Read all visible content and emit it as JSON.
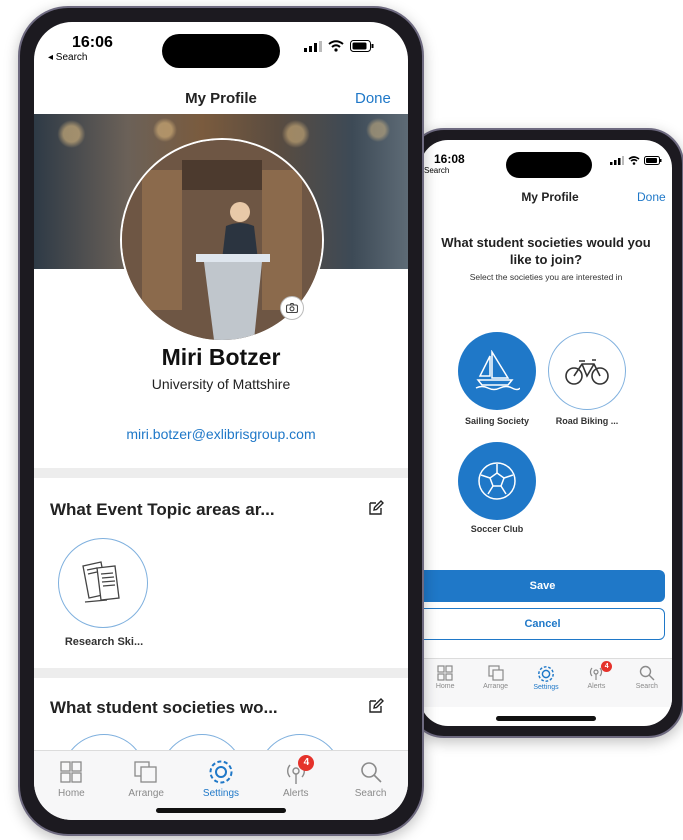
{
  "colors": {
    "accent": "#1f78c8",
    "badge": "#e5322b",
    "frame": "#1c1a20"
  },
  "front": {
    "status": {
      "time": "16:06",
      "back": "◂ Search"
    },
    "nav": {
      "title": "My Profile",
      "done": "Done"
    },
    "profile": {
      "name": "Miri Botzer",
      "institution": "University of Mattshire",
      "email": "miri.botzer@exlibrisgroup.com"
    },
    "sections": [
      {
        "title": "What Event Topic areas ar...",
        "items": [
          {
            "label": "Research Ski...",
            "icon": "books-icon"
          }
        ]
      },
      {
        "title": "What student societies wo..."
      }
    ],
    "tabs": [
      {
        "label": "Home",
        "icon": "grid-icon"
      },
      {
        "label": "Arrange",
        "icon": "stack-icon"
      },
      {
        "label": "Settings",
        "icon": "gear-icon"
      },
      {
        "label": "Alerts",
        "icon": "broadcast-icon",
        "badge": "4"
      },
      {
        "label": "Search",
        "icon": "search-icon"
      }
    ]
  },
  "back": {
    "status": {
      "time": "16:08",
      "back": "Search"
    },
    "nav": {
      "title": "My Profile",
      "done": "Done"
    },
    "heading": "What student societies would you like to join?",
    "subheading": "Select the societies you are interested in",
    "societies": [
      {
        "label": "Sailing Society",
        "icon": "sailboat-icon",
        "selected": true
      },
      {
        "label": "Road Biking ...",
        "icon": "bicycle-icon",
        "selected": false
      },
      {
        "label": "Soccer Club",
        "icon": "soccer-ball-icon",
        "selected": true
      }
    ],
    "save": "Save",
    "cancel": "Cancel",
    "tabs": [
      {
        "label": "Home"
      },
      {
        "label": "Arrange"
      },
      {
        "label": "Settings"
      },
      {
        "label": "Alerts",
        "badge": "4"
      },
      {
        "label": "Search"
      }
    ]
  }
}
